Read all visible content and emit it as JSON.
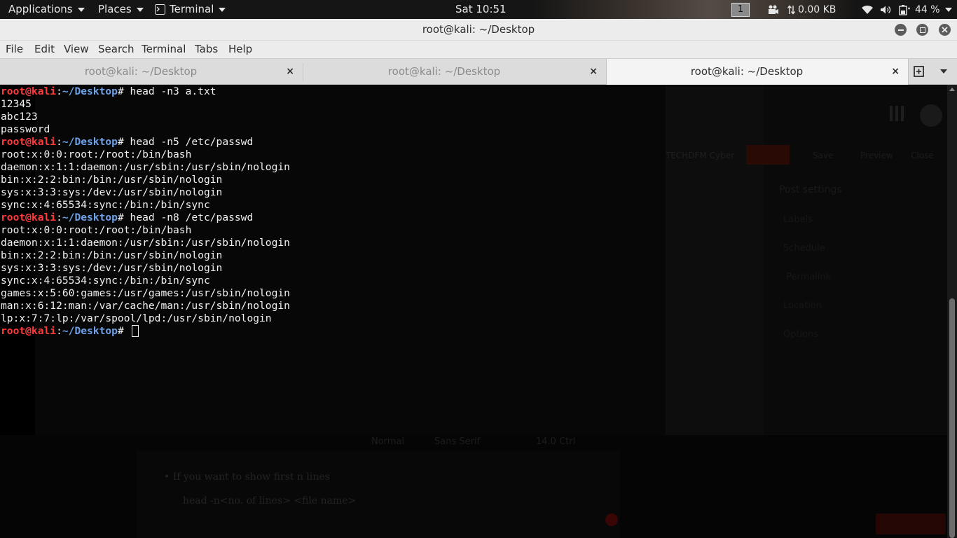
{
  "topbar": {
    "applications": "Applications",
    "places": "Places",
    "terminal": "Terminal",
    "clock": "Sat 10:51",
    "workspace": "1",
    "network_speed": "0.00 KB",
    "battery": "44 %"
  },
  "window": {
    "title": "root@kali: ~/Desktop"
  },
  "menubar": {
    "items": [
      "File",
      "Edit",
      "View",
      "Search",
      "Terminal",
      "Tabs",
      "Help"
    ]
  },
  "tabs": [
    {
      "label": "root@kali: ~/Desktop",
      "close": "×",
      "active": false
    },
    {
      "label": "root@kali: ~/Desktop",
      "close": "×",
      "active": false
    },
    {
      "label": "root@kali: ~/Desktop",
      "close": "×",
      "active": true
    }
  ],
  "terminal": {
    "prompt_user": "root@kali",
    "prompt_sep": ":",
    "prompt_path": "~/Desktop",
    "prompt_sym": "# ",
    "lines": [
      {
        "type": "cmd",
        "text": "head -n3 a.txt"
      },
      {
        "type": "out",
        "text": "12345"
      },
      {
        "type": "out",
        "text": "abc123"
      },
      {
        "type": "out",
        "text": "password"
      },
      {
        "type": "cmd",
        "text": "head -n5 /etc/passwd"
      },
      {
        "type": "out",
        "text": "root:x:0:0:root:/root:/bin/bash"
      },
      {
        "type": "out",
        "text": "daemon:x:1:1:daemon:/usr/sbin:/usr/sbin/nologin"
      },
      {
        "type": "out",
        "text": "bin:x:2:2:bin:/bin:/usr/sbin/nologin"
      },
      {
        "type": "out",
        "text": "sys:x:3:3:sys:/dev:/usr/sbin/nologin"
      },
      {
        "type": "out",
        "text": "sync:x:4:65534:sync:/bin:/bin/sync"
      },
      {
        "type": "cmd",
        "text": "head -n8 /etc/passwd"
      },
      {
        "type": "out",
        "text": "root:x:0:0:root:/root:/bin/bash"
      },
      {
        "type": "out",
        "text": "daemon:x:1:1:daemon:/usr/sbin:/usr/sbin/nologin"
      },
      {
        "type": "out",
        "text": "bin:x:2:2:bin:/bin:/usr/sbin/nologin"
      },
      {
        "type": "out",
        "text": "sys:x:3:3:sys:/dev:/usr/sbin/nologin"
      },
      {
        "type": "out",
        "text": "sync:x:4:65534:sync:/bin:/bin/sync"
      },
      {
        "type": "out",
        "text": "games:x:5:60:games:/usr/games:/usr/sbin/nologin"
      },
      {
        "type": "out",
        "text": "man:x:6:12:man:/var/cache/man:/usr/sbin/nologin"
      },
      {
        "type": "out",
        "text": "lp:x:7:7:lp:/var/spool/lpd:/usr/sbin/nologin"
      },
      {
        "type": "prompt",
        "text": ""
      }
    ]
  },
  "background_window": {
    "header_label": "TECHDFM Cyber",
    "buttons": [
      "Save",
      "Preview",
      "Close"
    ],
    "settings_title": "Post settings",
    "settings_items": [
      "Labels",
      "Schedule",
      "Permalink",
      "Location",
      "Options"
    ],
    "toolbar_items": [
      "Normal",
      "Sans Serif",
      "14.0 Ctrl"
    ],
    "body_bullet": "If you want to show first n lines",
    "body_code": "head -n<no. of lines> <file name>"
  },
  "colors": {
    "prompt_user": "#ff3b3b",
    "prompt_path": "#6ea2e8",
    "terminal_bg": "#000000",
    "terminal_fg": "#f0f0f0"
  }
}
